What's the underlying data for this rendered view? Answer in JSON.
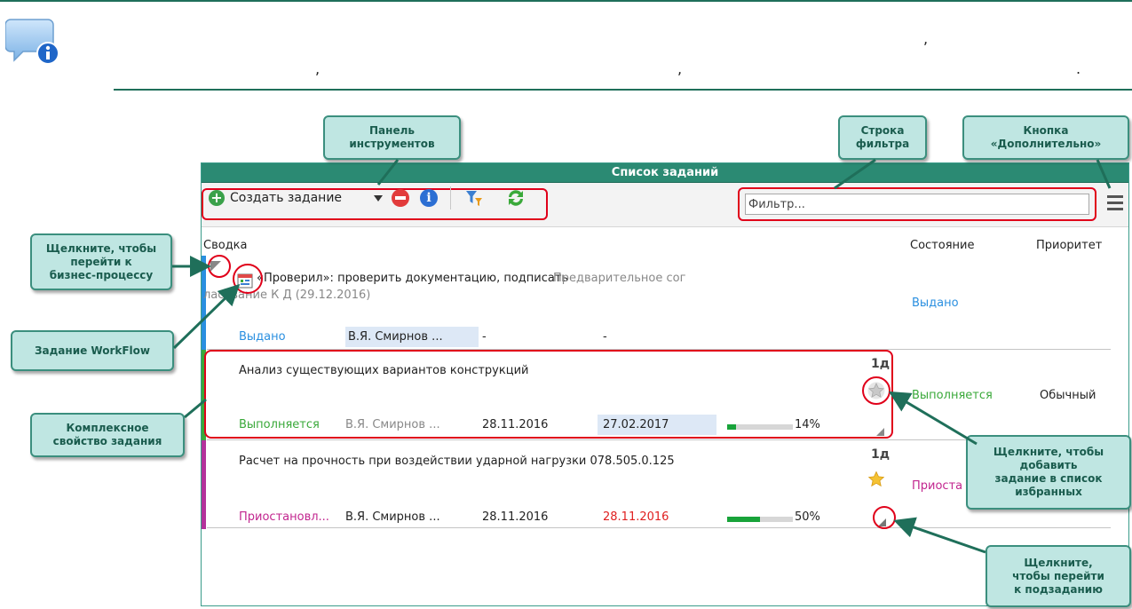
{
  "header": {
    "commas": [
      ",",
      ",",
      ","
    ],
    "period": "."
  },
  "window": {
    "title": "Список заданий",
    "toolbar": {
      "create_label": "Создать задание",
      "filter_placeholder": "Фильтр..."
    },
    "columns": {
      "summary": "Сводка",
      "state": "Состояние",
      "priority": "Приоритет"
    },
    "tasks": [
      {
        "title": "«Проверил»: проверить документацию, подписать",
        "title_extra": "Предварительное сог",
        "title_line2": "ласование К Д (29.12.2016)",
        "state": "Выдано",
        "status": "Выдано",
        "assignee": "В.Я. Смирнов ...",
        "start": "-",
        "due": "-",
        "color": "#2a8fe0"
      },
      {
        "title": "Анализ существующих вариантов конструкций",
        "days": "1д",
        "state": "Выполняется",
        "priority": "Обычный",
        "status": "Выполняется",
        "assignee": "В.Я. Смирнов ...",
        "start": "28.11.2016",
        "due": "27.02.2017",
        "progress": 14,
        "progress_label": "14%",
        "color": "#3aa93a"
      },
      {
        "title": "Расчет на прочность при воздействии ударной нагрузки 078.505.0.125",
        "days": "1д",
        "state": "Приоста",
        "status": "Приостановл...",
        "assignee": "В.Я. Смирнов ...",
        "start": "28.11.2016",
        "due": "28.11.2016",
        "progress": 50,
        "progress_label": "50%",
        "color": "#b4329b"
      }
    ]
  },
  "callouts": {
    "toolbar": "Панель\nинструментов",
    "filter": "Строка\nфильтра",
    "more": "Кнопка\n«Дополнительно»",
    "click_bp": "Щелкните, чтобы\nперейти к\nбизнес-процессу",
    "workflow": "Задание WorkFlow",
    "complex": "Комплексное\nсвойство задания",
    "favorites": "Щелкните, чтобы\nдобавить\nзадание в список\nизбранных",
    "subtask": "Щелкните,\nчтобы перейти\nк подзаданию"
  },
  "colors": {
    "accent": "#2b8a73",
    "callout_bg": "#bfe6e2",
    "highlight": "#e0001a",
    "status_issued": "#2a8fe0",
    "status_running": "#3aa93a",
    "status_paused": "#c2268f",
    "due_red": "#e02020"
  }
}
